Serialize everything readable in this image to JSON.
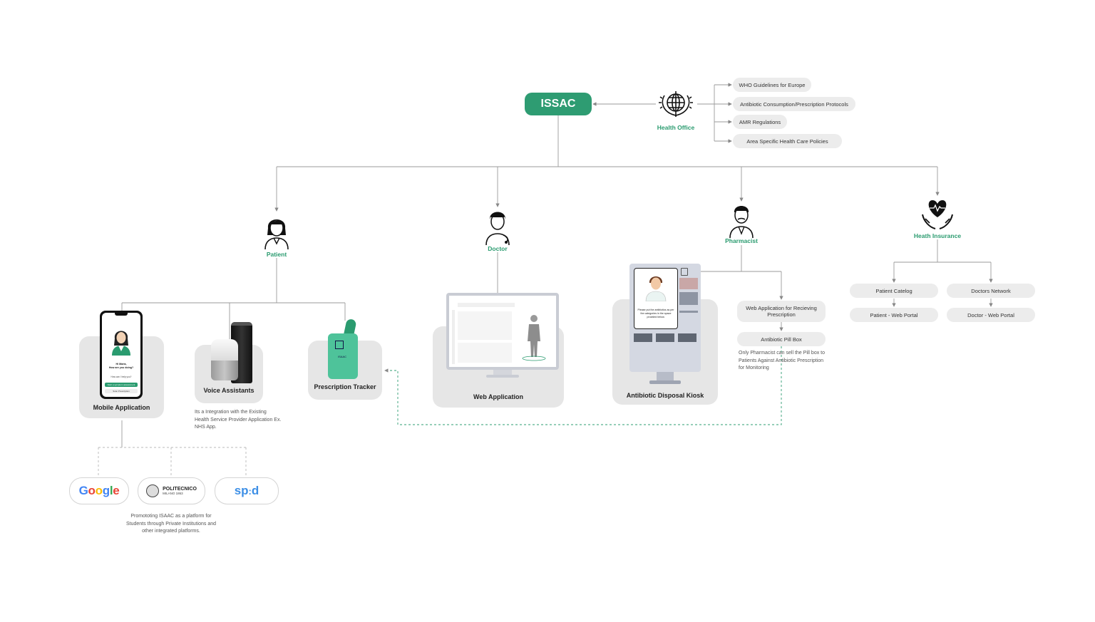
{
  "central": {
    "label": "ISSAC"
  },
  "health_office": {
    "label": "Health Office",
    "items": [
      "WHO Guidelines for Europe",
      "Antibiotic Consumption/Prescription Protocols",
      "AMR Regulations",
      "Area Specific Health Care Policies"
    ]
  },
  "roles": {
    "patient": "Patient",
    "doctor": "Doctor",
    "pharmacist": "Pharmacist",
    "insurance": "Heath Insurance"
  },
  "patient_channels": {
    "mobile": {
      "label": "Mobile Application",
      "greeting": "Hi Maria,\nHow are you doing?",
      "help": "How can I help you?",
      "btn1": "Start a symptom assessment",
      "btn2": "Scan Prescription"
    },
    "voice": {
      "label": "Voice Assistants",
      "note": "Its a Integration with the Existing Health Service Provider Application Ex. NHS App."
    },
    "tracker": {
      "label": "Prescription Tracker",
      "device_text": "ISAAC"
    }
  },
  "doctor_channel": {
    "label": "Web Application"
  },
  "kiosk": {
    "label": "Antibiotic Disposal Kiosk",
    "screen_text": "Please put the antibiotics as per the categories in the space provided below."
  },
  "pharmacist_items": {
    "web_app": "Web Application for Recieving Prescription",
    "pill_box": "Antibiotic Pill Box",
    "note": "Only Pharmacist can sell the Pill box to Patients Against Antibiotic Prescription for Monitoring"
  },
  "insurance_items": {
    "patient_catalog": "Patient Catelog",
    "doctors_network": "Doctors Network",
    "patient_portal": "Patient - Web Portal",
    "doctor_portal": "Doctor - Web Portal"
  },
  "partners": {
    "google": "Google",
    "polimi": "POLITECNICO",
    "polimi_sub": "MILANO 1863",
    "speed": "speed",
    "note": "Promototing ISAAC as a platform for Students through Private Institutions and other integrated platforms."
  },
  "colors": {
    "accent": "#2e9c72",
    "card": "#e6e6e6",
    "pill": "#ececec",
    "line": "#9a9a9a"
  }
}
